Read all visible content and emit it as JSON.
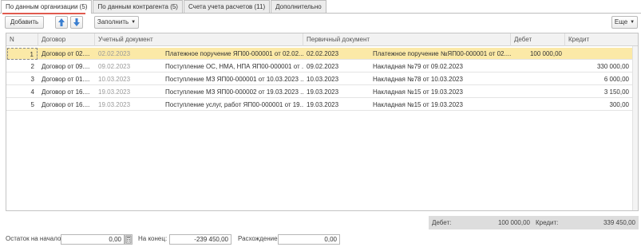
{
  "tabs": [
    {
      "label": "По данным организации (5)",
      "active": true
    },
    {
      "label": "По данным контрагента (5)",
      "active": false
    },
    {
      "label": "Счета учета расчетов (11)",
      "active": false
    },
    {
      "label": "Дополнительно",
      "active": false
    }
  ],
  "toolbar": {
    "add_label": "Добавить",
    "move_up_icon": "arrow-up-icon",
    "move_down_icon": "arrow-down-icon",
    "fill_label": "Заполнить",
    "more_label": "Еще"
  },
  "table": {
    "headers": {
      "n": "N",
      "contract": "Договор",
      "accounting_doc": "Учетный документ",
      "primary_doc": "Первичный документ",
      "debit": "Дебет",
      "credit": "Кредит"
    },
    "rows": [
      {
        "n": "1",
        "contract": "Договор от 02....",
        "acc_date": "02.02.2023",
        "acc_doc": "Платежное поручение ЯП00-000001 от 02.02....",
        "prim_date": "02.02.2023",
        "prim_doc": "Платежное поручение №ЯП00-000001 от 02....",
        "debit": "100 000,00",
        "credit": ""
      },
      {
        "n": "2",
        "contract": "Договор от 09....",
        "acc_date": "09.02.2023",
        "acc_doc": "Поступление ОС, НМА, НПА ЯП00-000001 от ...",
        "prim_date": "09.02.2023",
        "prim_doc": "Накладная №79 от 09.02.2023",
        "debit": "",
        "credit": "330 000,00"
      },
      {
        "n": "3",
        "contract": "Договор от 01....",
        "acc_date": "10.03.2023",
        "acc_doc": "Поступление МЗ ЯП00-000001 от 10.03.2023 ...",
        "prim_date": "10.03.2023",
        "prim_doc": "Накладная №78 от 10.03.2023",
        "debit": "",
        "credit": "6 000,00"
      },
      {
        "n": "4",
        "contract": "Договор от 16....",
        "acc_date": "19.03.2023",
        "acc_doc": "Поступление МЗ ЯП00-000002 от 19.03.2023 ...",
        "prim_date": "19.03.2023",
        "prim_doc": "Накладная №15 от 19.03.2023",
        "debit": "",
        "credit": "3 150,00"
      },
      {
        "n": "5",
        "contract": "Договор от 16....",
        "acc_date": "19.03.2023",
        "acc_doc": "Поступление услуг, работ ЯП00-000001 от 19....",
        "prim_date": "19.03.2023",
        "prim_doc": "Накладная №15 от 19.03.2023",
        "debit": "",
        "credit": "300,00"
      }
    ]
  },
  "totals": {
    "debit_label": "Дебет:",
    "debit_value": "100 000,00",
    "credit_label": "Кредит:",
    "credit_value": "339 450,00"
  },
  "footer": {
    "opening_label": "Остаток на начало:",
    "opening_value": "0,00",
    "end_label": "На конец:",
    "end_value": "-239 450,00",
    "diff_label": "Расхождение:",
    "diff_value": "0,00"
  },
  "colors": {
    "accent_underline": "#e05a4e",
    "selected_row": "#fbe9a7",
    "arrow_blue": "#3b7fd0"
  }
}
